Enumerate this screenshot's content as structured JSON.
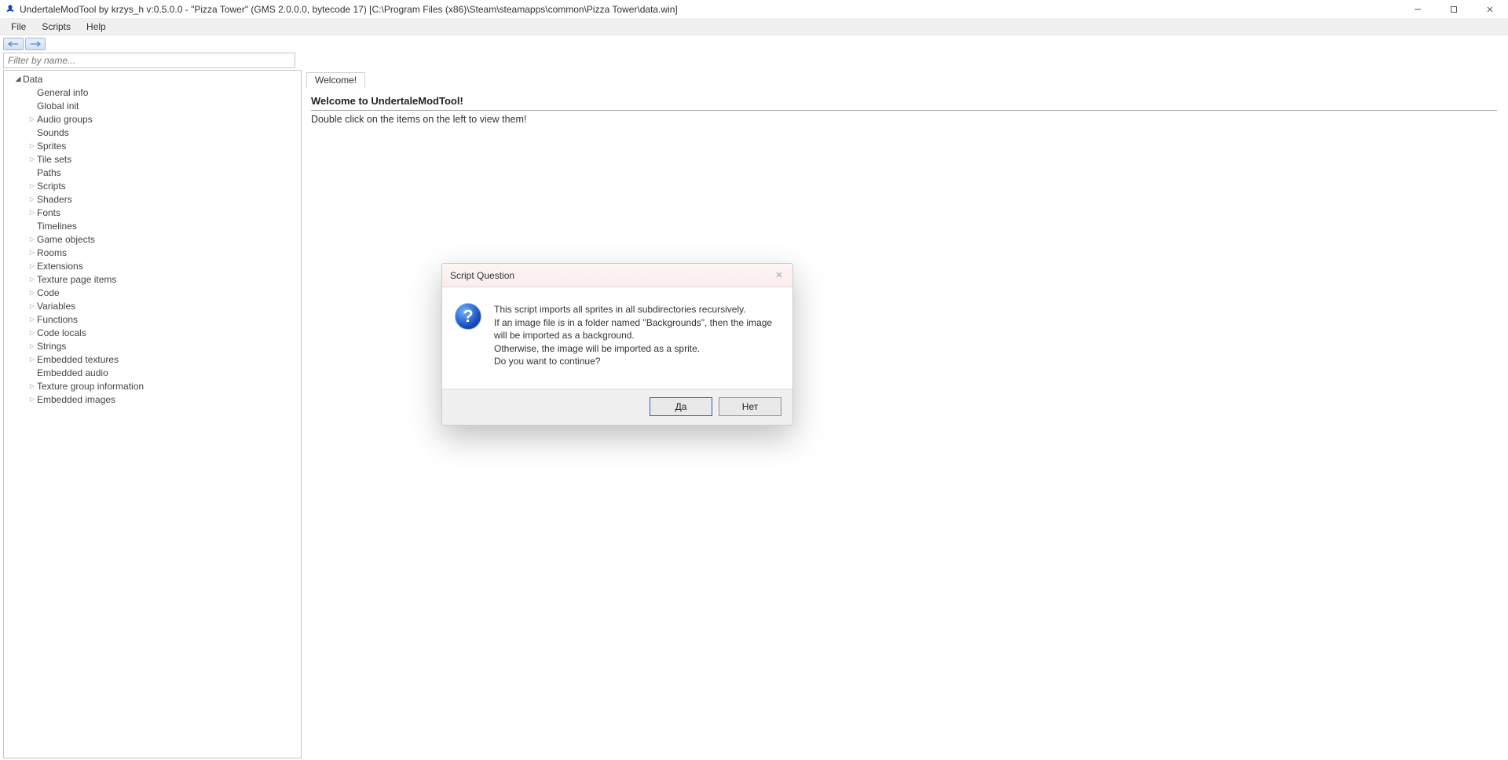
{
  "window": {
    "title": "UndertaleModTool by krzys_h v:0.5.0.0 - \"Pizza Tower\" (GMS 2.0.0.0, bytecode 17) [C:\\Program Files (x86)\\Steam\\steamapps\\common\\Pizza Tower\\data.win]"
  },
  "menubar": {
    "file": "File",
    "scripts": "Scripts",
    "help": "Help"
  },
  "filter": {
    "placeholder": "Filter by name..."
  },
  "tree": {
    "root": "Data",
    "items": [
      {
        "label": "General info",
        "expandable": false
      },
      {
        "label": "Global init",
        "expandable": false
      },
      {
        "label": "Audio groups",
        "expandable": true
      },
      {
        "label": "Sounds",
        "expandable": false
      },
      {
        "label": "Sprites",
        "expandable": true
      },
      {
        "label": "Tile sets",
        "expandable": true
      },
      {
        "label": "Paths",
        "expandable": false
      },
      {
        "label": "Scripts",
        "expandable": true
      },
      {
        "label": "Shaders",
        "expandable": true
      },
      {
        "label": "Fonts",
        "expandable": true
      },
      {
        "label": "Timelines",
        "expandable": false
      },
      {
        "label": "Game objects",
        "expandable": true
      },
      {
        "label": "Rooms",
        "expandable": true
      },
      {
        "label": "Extensions",
        "expandable": true
      },
      {
        "label": "Texture page items",
        "expandable": true
      },
      {
        "label": "Code",
        "expandable": true
      },
      {
        "label": "Variables",
        "expandable": true
      },
      {
        "label": "Functions",
        "expandable": true
      },
      {
        "label": "Code locals",
        "expandable": true
      },
      {
        "label": "Strings",
        "expandable": true
      },
      {
        "label": "Embedded textures",
        "expandable": true
      },
      {
        "label": "Embedded audio",
        "expandable": false
      },
      {
        "label": "Texture group information",
        "expandable": true
      },
      {
        "label": "Embedded images",
        "expandable": true
      }
    ]
  },
  "tab": {
    "welcome": "Welcome!"
  },
  "content": {
    "heading": "Welcome to UndertaleModTool!",
    "subtext": "Double click on the items on the left to view them!"
  },
  "dialog": {
    "title": "Script Question",
    "line1": "This script imports all sprites in all subdirectories recursively.",
    "line2": "If an image file is in a folder named \"Backgrounds\", then the image will be imported as a background.",
    "line3": "Otherwise, the image will be imported as a sprite.",
    "line4": "Do you want to continue?",
    "yes": "Да",
    "no": "Нет"
  }
}
